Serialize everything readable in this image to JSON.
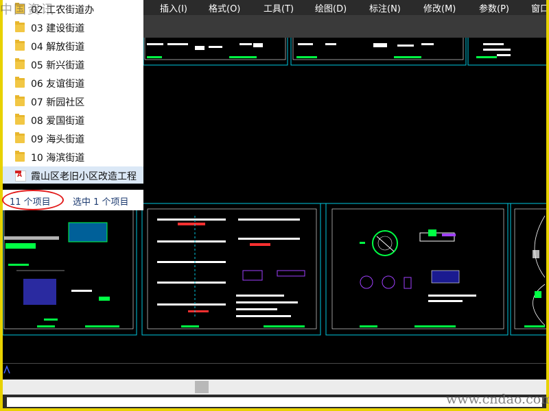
{
  "cad_menu": [
    {
      "label": "插入(I)"
    },
    {
      "label": "格式(O)"
    },
    {
      "label": "工具(T)"
    },
    {
      "label": "绘图(D)"
    },
    {
      "label": "标注(N)"
    },
    {
      "label": "修改(M)"
    },
    {
      "label": "参数(P)"
    },
    {
      "label": "窗口"
    }
  ],
  "explorer": {
    "items": [
      {
        "label": "02 工农街道办",
        "icon": "folder-icon"
      },
      {
        "label": "03 建设街道",
        "icon": "folder-icon"
      },
      {
        "label": "04 解放街道",
        "icon": "folder-icon"
      },
      {
        "label": "05 新兴街道",
        "icon": "folder-icon"
      },
      {
        "label": "06 友谊街道",
        "icon": "folder-icon"
      },
      {
        "label": "07 新园社区",
        "icon": "folder-icon"
      },
      {
        "label": "08 爱国街道",
        "icon": "folder-icon"
      },
      {
        "label": "09 海头街道",
        "icon": "folder-icon"
      },
      {
        "label": "10 海滨街道",
        "icon": "folder-icon"
      },
      {
        "label": "霞山区老旧小区改造工程",
        "icon": "pdf-icon"
      }
    ],
    "status": {
      "count": "11 个项目",
      "selected": "选中 1 个项目"
    }
  },
  "watermark": {
    "top": "中国资讯",
    "bottom": "www.cndao.com"
  },
  "colors": {
    "cad_background": "#000000",
    "viewport_border": "#00c8e0",
    "annotation_oval": "#e21a1a",
    "highlight_yellow": "#e8d200"
  }
}
